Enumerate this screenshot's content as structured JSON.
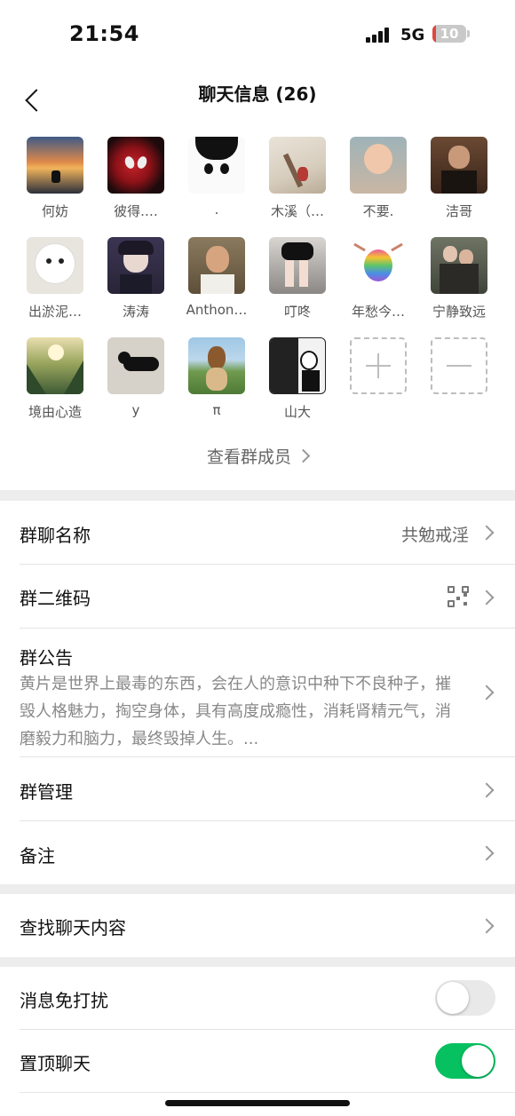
{
  "status_bar": {
    "time": "21:54",
    "network": "5G",
    "battery": "10",
    "battery_level": 0.1
  },
  "nav": {
    "title": "聊天信息 (26)",
    "back_icon": "chevron-left-icon"
  },
  "members": [
    {
      "name": "何妨",
      "avatar": "sunset-beach-avatar"
    },
    {
      "name": "彼得.…",
      "avatar": "spiderman-avatar"
    },
    {
      "name": ".",
      "avatar": "cartoon-boy-avatar"
    },
    {
      "name": "木溪（…",
      "avatar": "ink-painting-avatar"
    },
    {
      "name": "不要.",
      "avatar": "baby-avatar"
    },
    {
      "name": "洁哥",
      "avatar": "godfather-avatar"
    },
    {
      "name": "出淤泥…",
      "avatar": "white-dog-avatar"
    },
    {
      "name": "涛涛",
      "avatar": "anime-boy-avatar"
    },
    {
      "name": "Anthon…",
      "avatar": "man-peace-sign-avatar"
    },
    {
      "name": "叮咚",
      "avatar": "legs-avatar"
    },
    {
      "name": "年愁今…",
      "avatar": "rainbow-figure-avatar"
    },
    {
      "name": "宁静致远",
      "avatar": "couple-avatar"
    },
    {
      "name": "境由心造",
      "avatar": "valley-sunlight-avatar"
    },
    {
      "name": "y",
      "avatar": "black-cat-avatar"
    },
    {
      "name": "π",
      "avatar": "dog-field-avatar"
    },
    {
      "name": "山大",
      "avatar": "comic-avatar"
    }
  ],
  "add_member_icon": "plus-icon",
  "remove_member_icon": "minus-icon",
  "view_all_members": "查看群成员",
  "settings": {
    "group_name": {
      "label": "群聊名称",
      "value": "共勉戒淫"
    },
    "qr_code": {
      "label": "群二维码",
      "icon": "qr-code-icon"
    },
    "announcement": {
      "label": "群公告",
      "text": "黄片是世界上最毒的东西，会在人的意识中种下不良种子，摧毁人格魅力，掏空身体，具有高度成瘾性，消耗肾精元气，消磨毅力和脑力，最终毁掉人生。..."
    },
    "manage": {
      "label": "群管理"
    },
    "remark": {
      "label": "备注"
    },
    "search_history": {
      "label": "查找聊天内容"
    },
    "mute": {
      "label": "消息免打扰",
      "on": false
    },
    "pin": {
      "label": "置顶聊天",
      "on": true
    }
  },
  "colors": {
    "accent": "#07c160",
    "background": "#ededed",
    "toggle_off": "#e9e9ea"
  }
}
